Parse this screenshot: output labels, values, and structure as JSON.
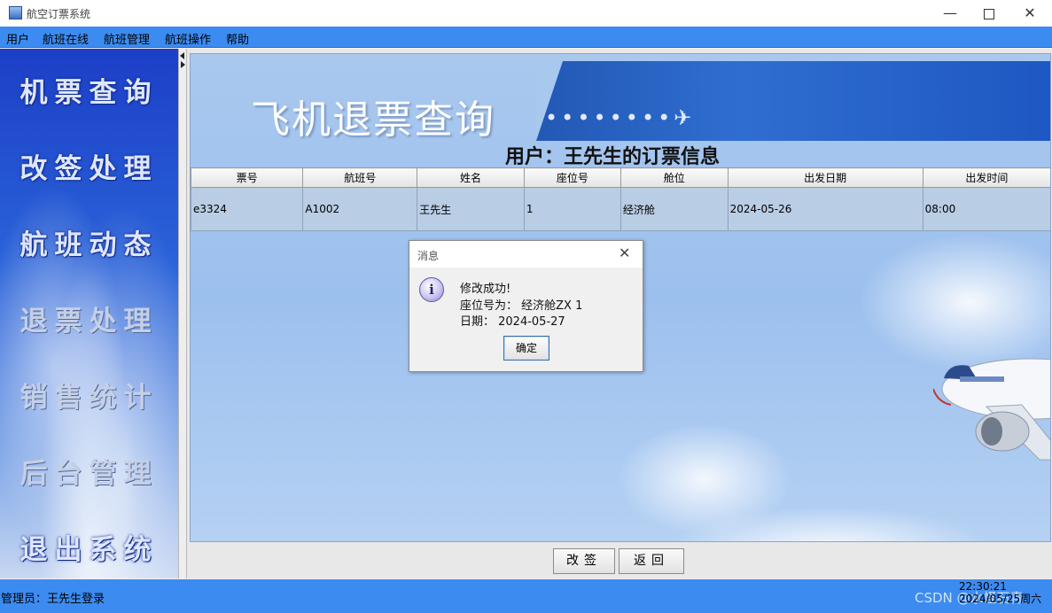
{
  "window": {
    "title": "航空订票系统",
    "minimize": "—",
    "close": "✕"
  },
  "menu": [
    "用户",
    "航班在线",
    "航班管理",
    "航班操作",
    "帮助"
  ],
  "sidebar": [
    "机票查询",
    "改签处理",
    "航班动态",
    "退票处理",
    "销售统计",
    "后台管理",
    "退出系统"
  ],
  "banner": {
    "title": "飞机退票查询",
    "stripe_text": "••••••••✈"
  },
  "user_info": "用户：王先生的订票信息",
  "table": {
    "headers": [
      "票号",
      "航班号",
      "姓名",
      "座位号",
      "舱位",
      "出发日期",
      "出发时间"
    ],
    "rows": [
      [
        "e3324",
        "A1002",
        "王先生",
        "1",
        "经济舱",
        "2024-05-26",
        "08:00"
      ]
    ]
  },
  "dialog": {
    "title": "消息",
    "icon": "i",
    "lines": [
      "修改成功!",
      "座位号为：  经济舱ZX 1",
      "日期：  2024-05-27"
    ],
    "ok": "确定"
  },
  "buttons": {
    "change": "改签",
    "back": "返回"
  },
  "status": {
    "left": "管理员：王先生登录",
    "time": "22:30:21",
    "date": "2024/05/25周六",
    "watermark": "CSDN @水怪石青"
  }
}
